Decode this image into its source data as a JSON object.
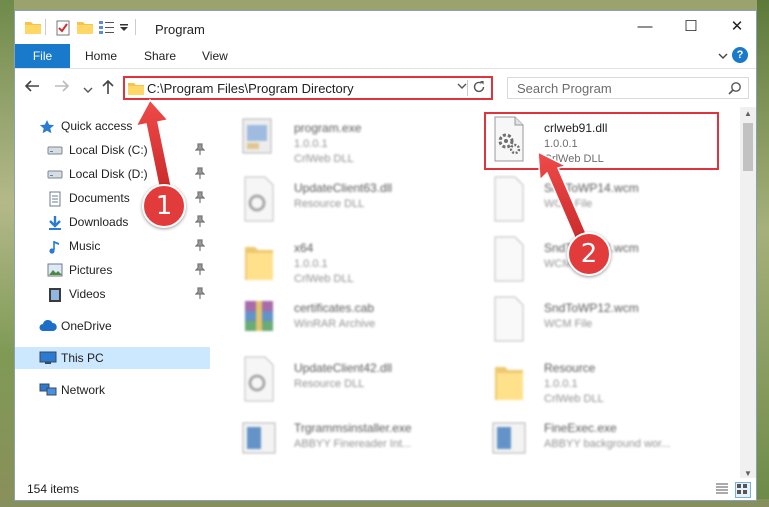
{
  "window": {
    "title": "Program",
    "minimize": "—",
    "maximize": "☐",
    "close": "✕"
  },
  "ribbon": {
    "tabs": [
      "File",
      "Home",
      "Share",
      "View"
    ],
    "help": "?"
  },
  "address": {
    "path": "C:\\Program Files\\Program Directory"
  },
  "search": {
    "placeholder": "Search Program"
  },
  "nav": {
    "items": [
      {
        "label": "Quick access",
        "icon": "star-icon"
      },
      {
        "label": "Local Disk (C:)",
        "icon": "drive-icon",
        "pinned": true
      },
      {
        "label": "Local Disk (D:)",
        "icon": "drive-icon",
        "pinned": true
      },
      {
        "label": "Documents",
        "icon": "documents-icon",
        "pinned": true
      },
      {
        "label": "Downloads",
        "icon": "download-icon",
        "pinned": true
      },
      {
        "label": "Music",
        "icon": "music-icon",
        "pinned": true
      },
      {
        "label": "Pictures",
        "icon": "pictures-icon",
        "pinned": true
      },
      {
        "label": "Videos",
        "icon": "videos-icon",
        "pinned": true
      },
      {
        "label": "OneDrive",
        "icon": "cloud-icon"
      },
      {
        "label": "This PC",
        "icon": "computer-icon",
        "selected": true
      },
      {
        "label": "Network",
        "icon": "network-icon"
      }
    ]
  },
  "files": [
    {
      "name": "program.exe",
      "version": "1.0.0.1",
      "desc": "CrlWeb DLL",
      "icon": "exe-icon"
    },
    {
      "name": "crlweb91.dll",
      "version": "1.0.0.1",
      "desc": "CrlWeb DLL",
      "icon": "dll-gear-icon",
      "highlighted": true
    },
    {
      "name": "UpdateClient63.dll",
      "version": "",
      "desc": "Resource DLL",
      "icon": "dll-gear-icon"
    },
    {
      "name": "SndToWP14.wcm",
      "version": "",
      "desc": "WCM File",
      "icon": "file-icon"
    },
    {
      "name": "x64",
      "version": "1.0.0.1",
      "desc": "CrlWeb DLL",
      "icon": "folder-icon"
    },
    {
      "name": "SndToWP13.wcm",
      "version": "",
      "desc": "WCM File",
      "icon": "file-icon"
    },
    {
      "name": "certificates.cab",
      "version": "",
      "desc": "WinRAR Archive",
      "icon": "archive-icon"
    },
    {
      "name": "SndToWP12.wcm",
      "version": "",
      "desc": "WCM File",
      "icon": "file-icon"
    },
    {
      "name": "UpdateClient42.dll",
      "version": "",
      "desc": "Resource DLL",
      "icon": "dll-gear-icon"
    },
    {
      "name": "Resource",
      "version": "1.0.0.1",
      "desc": "CrlWeb DLL",
      "icon": "folder-icon"
    },
    {
      "name": "Trgrammsinstaller.exe",
      "version": "",
      "desc": "ABBYY Finereader Int...",
      "icon": "app-icon"
    },
    {
      "name": "FineExec.exe",
      "version": "",
      "desc": "ABBYY background wor...",
      "icon": "app-icon"
    }
  ],
  "status": {
    "count": "154 items"
  },
  "callouts": [
    "1",
    "2"
  ]
}
